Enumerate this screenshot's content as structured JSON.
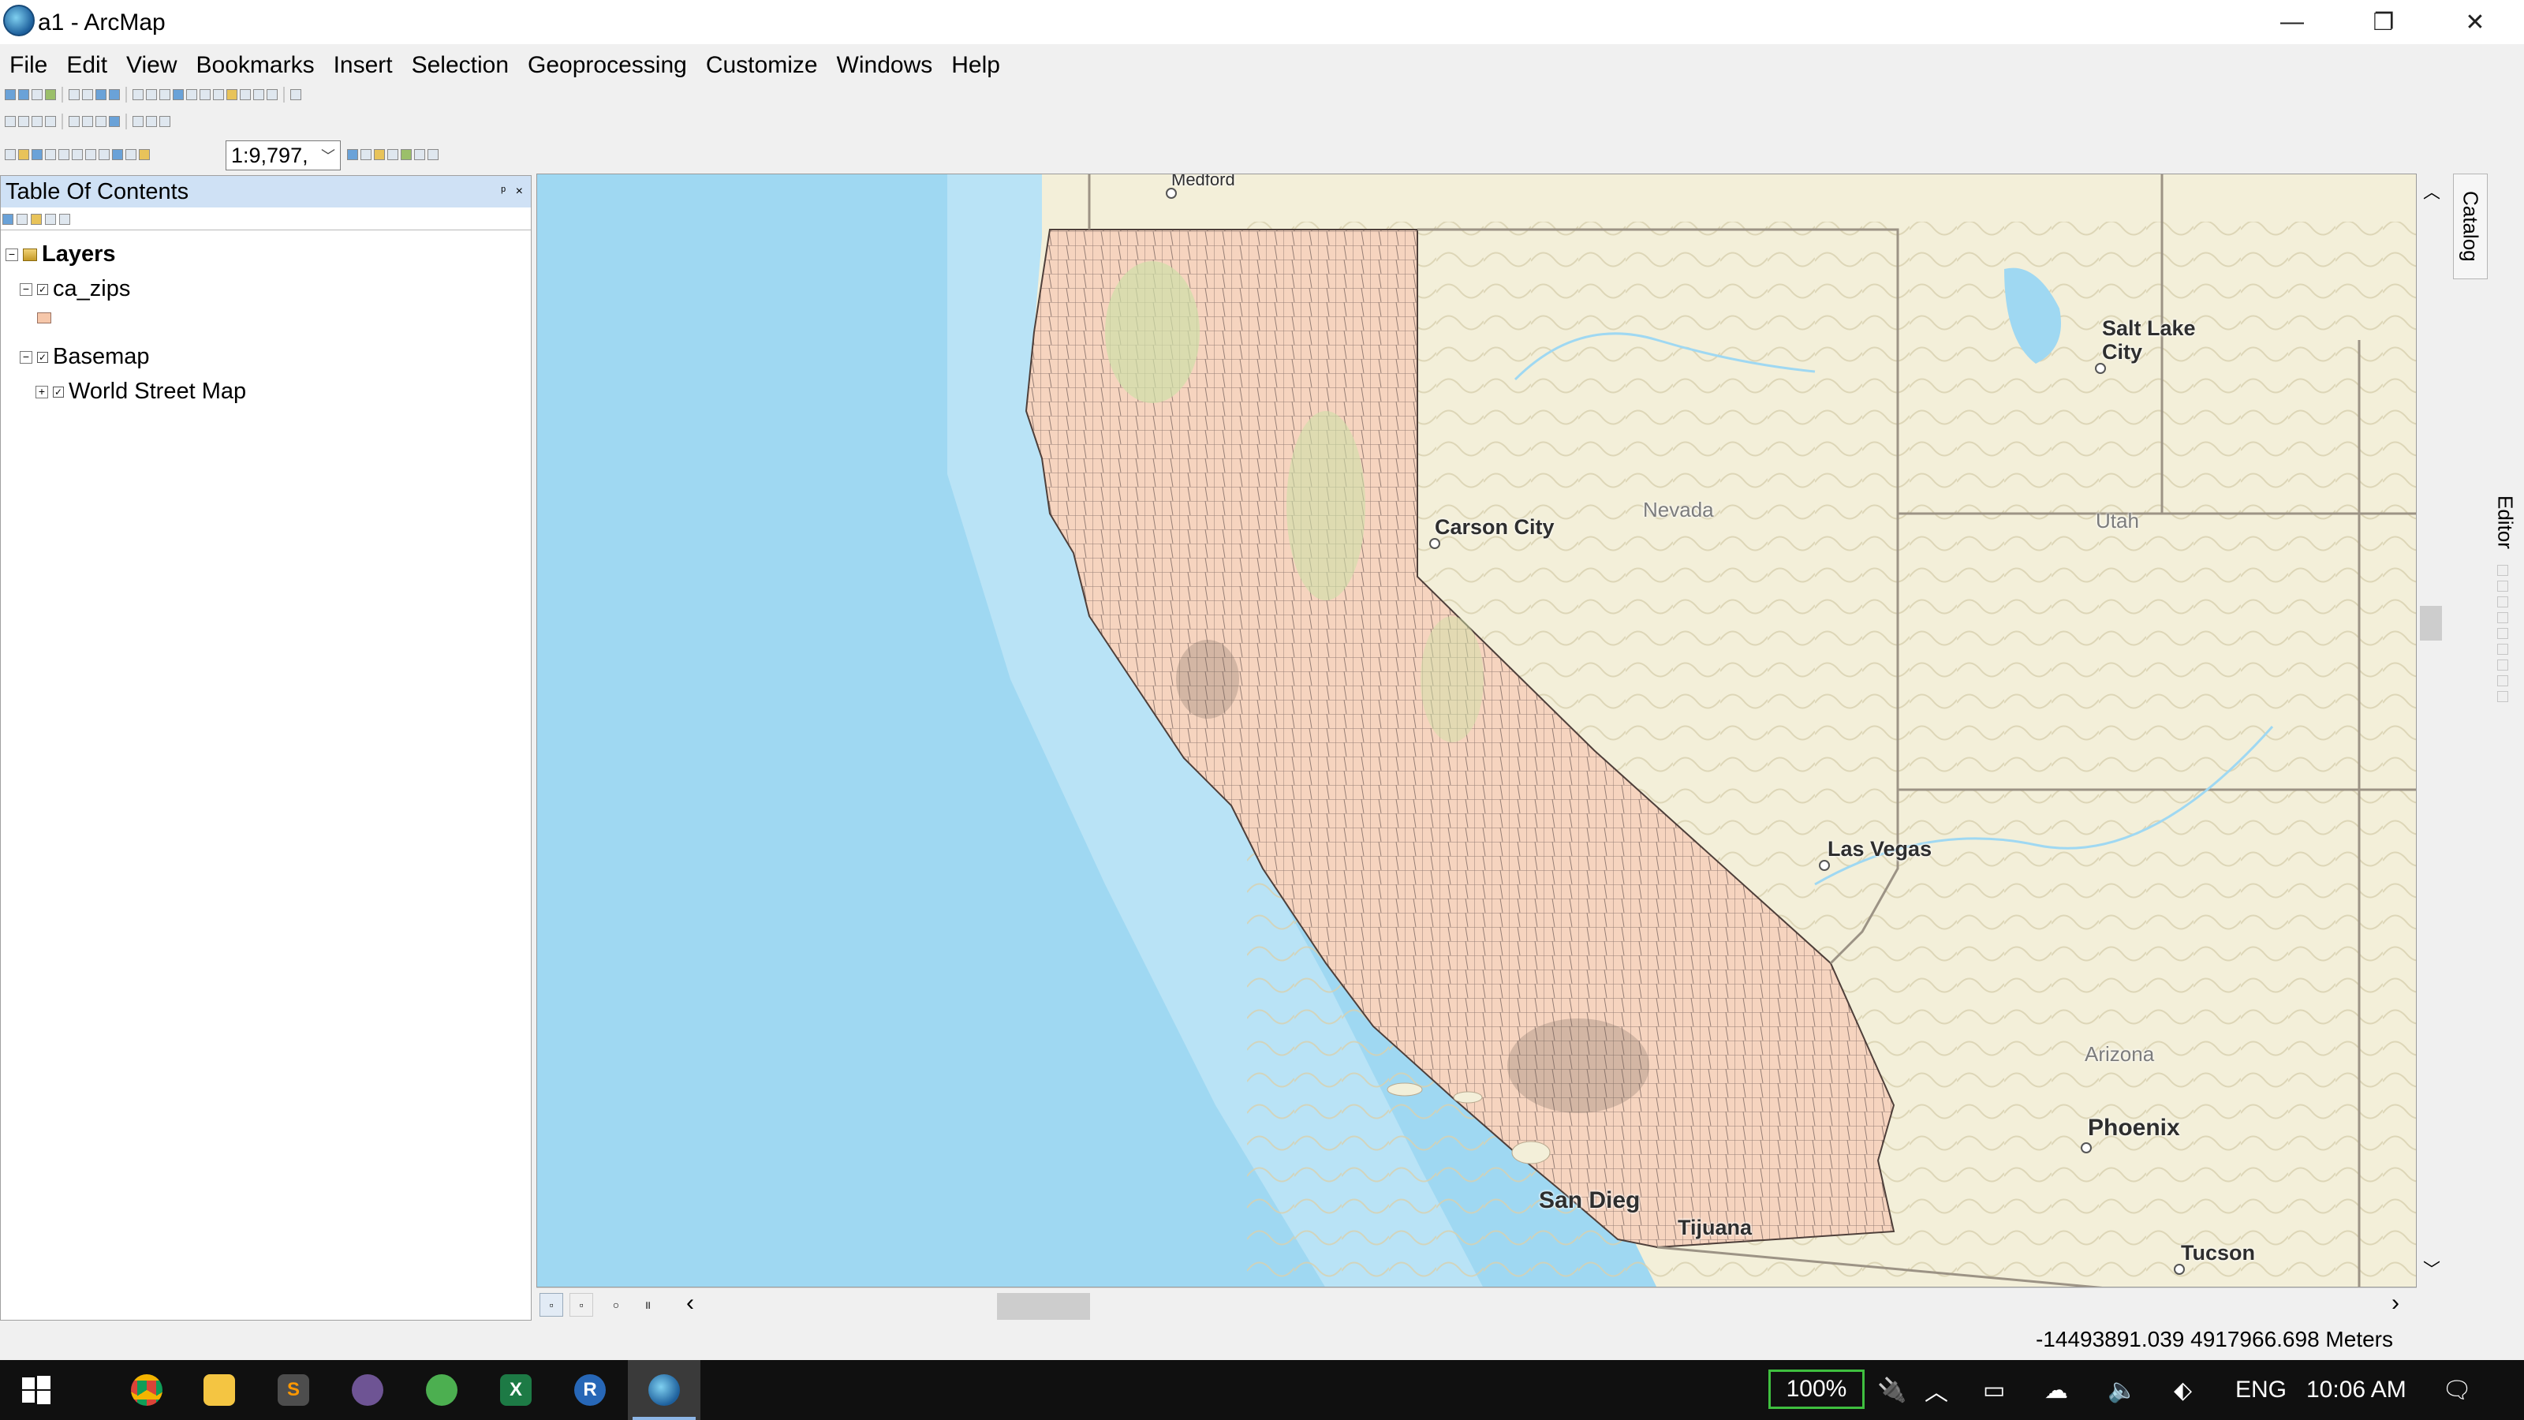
{
  "window": {
    "title": "a1 - ArcMap",
    "controls": [
      "—",
      "❐",
      "✕"
    ]
  },
  "menu": [
    "File",
    "Edit",
    "View",
    "Bookmarks",
    "Insert",
    "Selection",
    "Geoprocessing",
    "Customize",
    "Windows",
    "Help"
  ],
  "toolbar": {
    "scale": "1:9,797,"
  },
  "toc": {
    "title": "Table Of Contents",
    "header_buttons": "ᵖ ×",
    "tree": {
      "root": "Layers",
      "layer1": "ca_zips",
      "group": "Basemap",
      "basemap_layer": "World Street Map"
    }
  },
  "map": {
    "labels": {
      "medford": "Medford",
      "salt_lake": "Salt Lake\nCity",
      "carson": "Carson City",
      "nevada": "Nevada",
      "utah": "Utah",
      "las_vegas": "Las Vegas",
      "arizona": "Arizona",
      "phoenix": "Phoenix",
      "san_diego": "San Dieg",
      "tijuana": "Tijuana",
      "tucson": "Tucson"
    },
    "colors": {
      "ocean": "#9fd8f2",
      "land": "#f3efd9",
      "zips": "#f6d4bf",
      "forest": "#cfe0a8"
    }
  },
  "side_tabs": {
    "catalog": "Catalog",
    "editor": "Editor"
  },
  "status": {
    "coordinates": "-14493891.039  4917966.698 Meters"
  },
  "taskbar": {
    "battery": "100%",
    "language": "ENG",
    "time": "10:06 AM",
    "apps": [
      "chrome",
      "file-explorer",
      "sublime",
      "github",
      "spyder",
      "excel",
      "r",
      "arcmap"
    ]
  }
}
